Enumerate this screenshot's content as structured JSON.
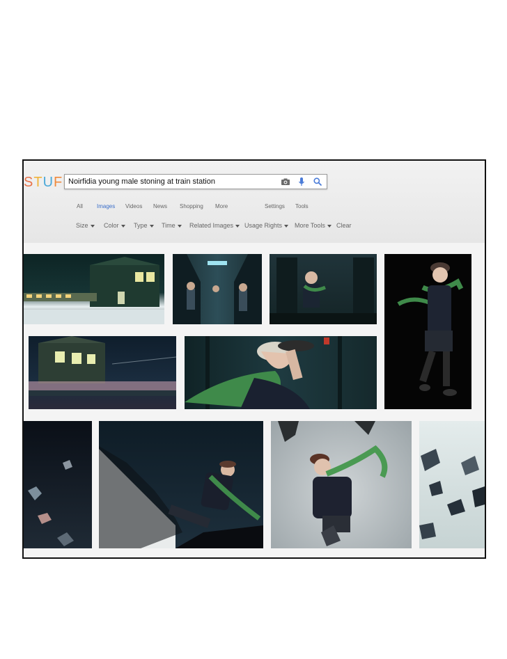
{
  "logo": {
    "text": "STUFF",
    "letters": [
      "S",
      "T",
      "U",
      "F",
      "F"
    ],
    "colors": [
      "#e8734a",
      "#f0b43c",
      "#4aa8d8",
      "#f08a3c",
      "#f0b43c"
    ]
  },
  "search": {
    "value": "Noirfidia young male stoning at train station",
    "icons": [
      "camera-icon",
      "microphone-icon",
      "search-icon"
    ]
  },
  "tabs": {
    "all": "All",
    "images": "Images",
    "videos": "Videos",
    "news": "News",
    "shopping": "Shopping",
    "more": "More",
    "settings": "Settings",
    "tools": "Tools"
  },
  "filters": {
    "size": "Size",
    "color": "Color",
    "type": "Type",
    "time": "Time",
    "related": "Related Images",
    "rights": "Usage Rights",
    "more_tools": "More Tools",
    "clear": "Clear"
  },
  "colors": {
    "accent": "#3a6ec9",
    "night": "#0e1a24",
    "scarf": "#3f8a4a"
  },
  "results": [
    "snowy-station-night",
    "train-interior-passengers",
    "boy-sitting-train",
    "boy-walking-black",
    "station-building-night",
    "boy-adjusting-cap-train",
    "boy-falling-rocks",
    "boy-slipping-snow",
    "boy-crouching-scarf",
    "flying-rocks"
  ]
}
